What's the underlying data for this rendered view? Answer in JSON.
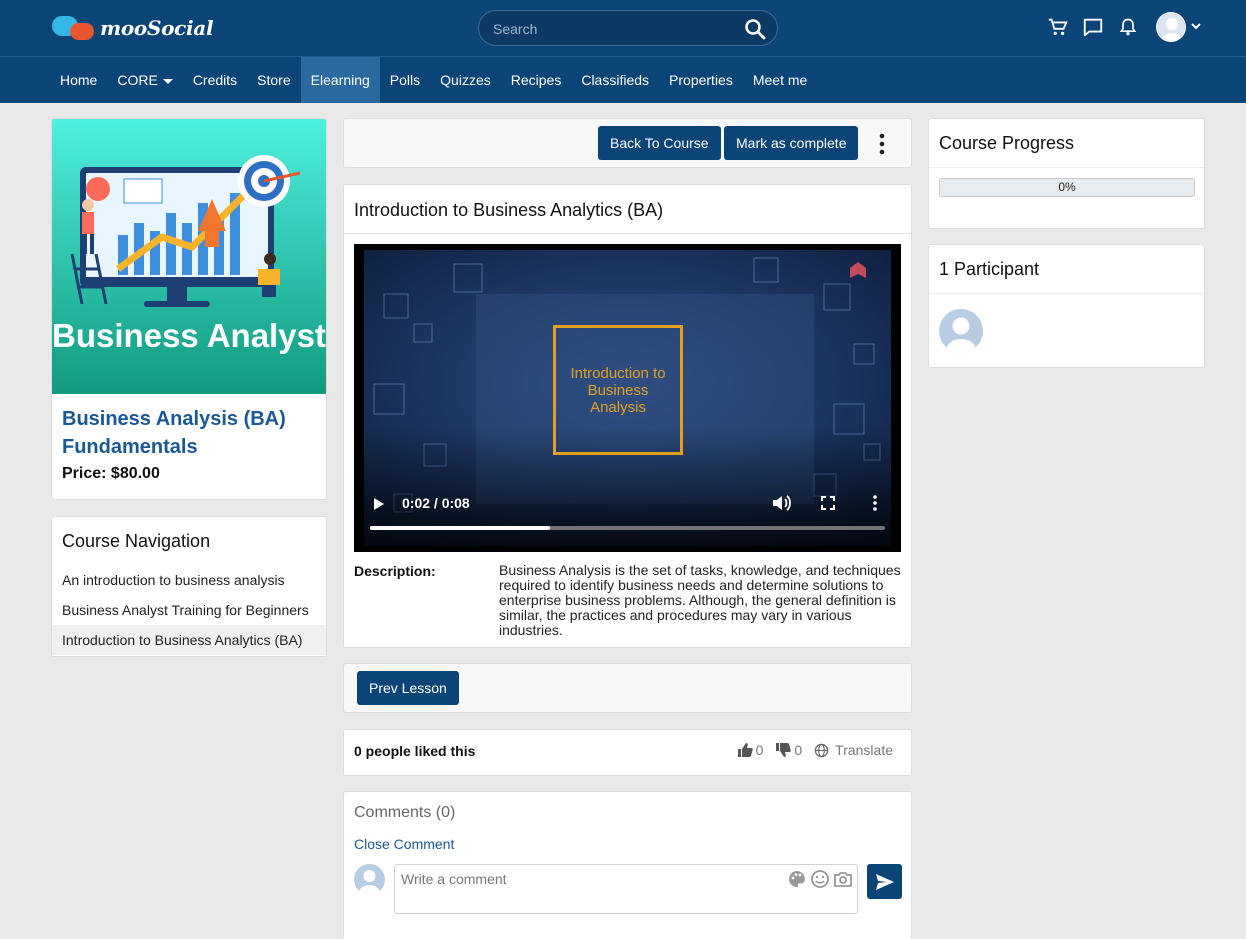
{
  "header": {
    "logo_text": "mooSocial",
    "search_placeholder": "Search",
    "icons": [
      "cart-icon",
      "chat-icon",
      "bell-icon",
      "user-avatar",
      "chevron-down-icon"
    ]
  },
  "nav": {
    "items": [
      {
        "label": "Home"
      },
      {
        "label": "CORE"
      },
      {
        "label": "Credits"
      },
      {
        "label": "Store"
      },
      {
        "label": "Elearning"
      },
      {
        "label": "Polls"
      },
      {
        "label": "Quizzes"
      },
      {
        "label": "Recipes"
      },
      {
        "label": "Classifieds"
      },
      {
        "label": "Properties"
      },
      {
        "label": "Meet me"
      }
    ],
    "active": "Elearning"
  },
  "course": {
    "image_text": "Business Analyst",
    "title": "Business Analysis (BA) Fundamentals",
    "price": "Price: $80.00"
  },
  "course_navigation": {
    "title": "Course Navigation",
    "items": [
      {
        "label": "An introduction to business analysis"
      },
      {
        "label": "Business Analyst Training for Beginners"
      },
      {
        "label": "Introduction to Business Analytics (BA)"
      }
    ],
    "active_index": 2
  },
  "actions": {
    "back_label": "Back To Course",
    "complete_label": "Mark as complete"
  },
  "lesson": {
    "title": "Introduction to Business Analytics (BA)",
    "video": {
      "overlay_title": "Introduction to Business Analysis",
      "time": "0:02 / 0:08",
      "progress": 0.35
    },
    "description_label": "Description:",
    "description": "Business Analysis is the set of tasks, knowledge, and techniques required to identify business needs and determine solutions to enterprise business problems. Although, the general definition is similar, the practices and procedures may vary in various industries."
  },
  "prev_lesson_label": "Prev Lesson",
  "likes": {
    "text": "0 people liked this",
    "like_count": "0",
    "dislike_count": "0",
    "translate_label": "Translate"
  },
  "comments": {
    "title": "Comments (0)",
    "close_label": "Close Comment",
    "placeholder": "Write a comment"
  },
  "progress": {
    "title": "Course Progress",
    "value": 0,
    "label": "0%"
  },
  "participants": {
    "title": "1 Participant"
  },
  "colors": {
    "brand": "#0b4577",
    "active_nav": "#2a6aa1",
    "link": "#1a5894",
    "accent": "#e3a020"
  }
}
